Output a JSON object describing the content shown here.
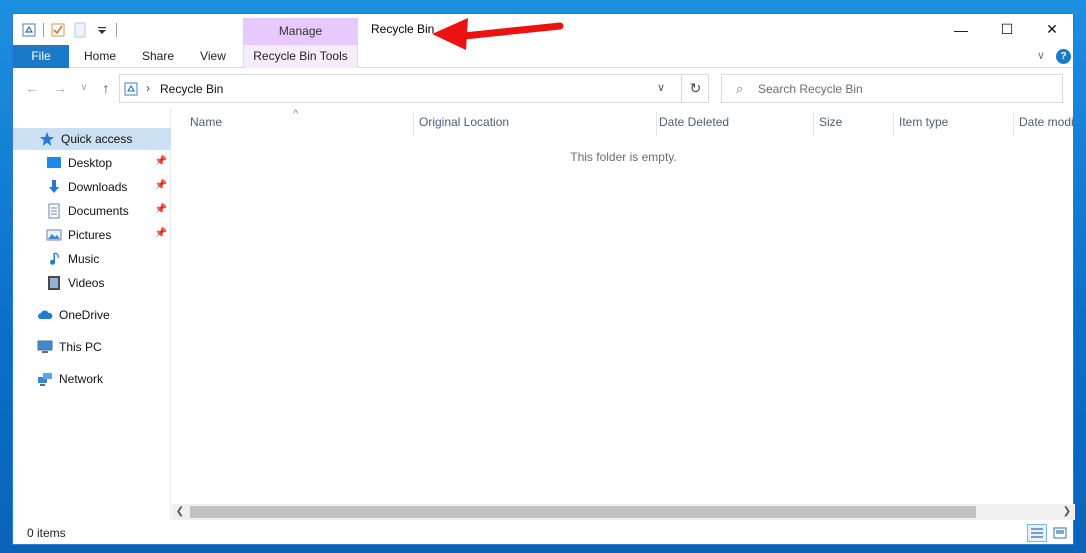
{
  "window": {
    "title": "Recycle Bin",
    "context_tab": "Manage",
    "controls": {
      "minimize": "—",
      "maximize": "☐",
      "close": "✕"
    }
  },
  "ribbon": {
    "tabs": [
      "File",
      "Home",
      "Share",
      "View"
    ],
    "tools_tab": "Recycle Bin Tools",
    "collapse": "∨",
    "help": "?"
  },
  "address": {
    "crumb": "Recycle Bin",
    "separator": "›",
    "dropdown": "∨",
    "refresh": "↻"
  },
  "search": {
    "placeholder": "Search Recycle Bin"
  },
  "navpane": {
    "quick_access": "Quick access",
    "pinned": [
      {
        "label": "Desktop",
        "icon": "desktop-icon"
      },
      {
        "label": "Downloads",
        "icon": "downloads-icon"
      },
      {
        "label": "Documents",
        "icon": "documents-icon"
      },
      {
        "label": "Pictures",
        "icon": "pictures-icon"
      }
    ],
    "unpinned": [
      {
        "label": "Music",
        "icon": "music-icon"
      },
      {
        "label": "Videos",
        "icon": "videos-icon"
      }
    ],
    "onedrive": "OneDrive",
    "thispc": "This PC",
    "network": "Network"
  },
  "columns": [
    "Name",
    "Original Location",
    "Date Deleted",
    "Size",
    "Item type",
    "Date modified"
  ],
  "empty_message": "This folder is empty.",
  "status": {
    "items": "0 items"
  },
  "colors": {
    "file_tab": "#1979ca",
    "manage_tab": "#e8c9ff",
    "selection": "#cce0f4",
    "annotation_arrow": "#e11"
  }
}
